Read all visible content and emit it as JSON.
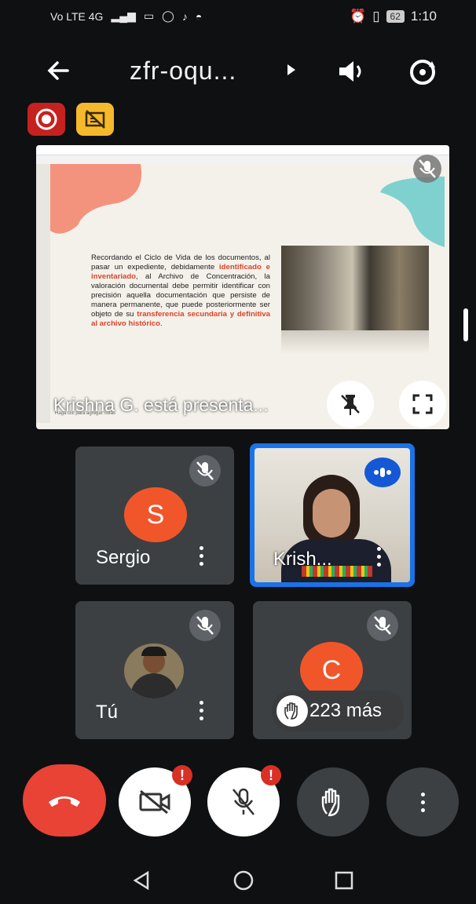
{
  "status_bar": {
    "network": "Vo LTE 4G",
    "battery": "62",
    "time": "1:10"
  },
  "header": {
    "title": "zfr-oqu..."
  },
  "presentation": {
    "slide_text_parts": [
      "Recordando el Ciclo de Vida de los documentos, al pasar un expediente, debidamente ",
      "identificado e inventariado",
      ", al Archivo de Concentración, la valoración documental debe permitir identificar con precisión aquella documentación que persiste de manera permanente, que puede posteriormente ser objeto de su ",
      "transferencia secundaria y definitiva al archivo histórico",
      "."
    ],
    "presenting_label": "Krishna G. está presenta...",
    "notes_hint": "Haga clic para agregar notas",
    "accent_color": "#d8442a"
  },
  "participants": [
    {
      "name": "Sergio",
      "initial": "S",
      "muted": true
    },
    {
      "name": "Krish...",
      "speaking": true
    },
    {
      "name": "Tú",
      "muted": true
    },
    {
      "initial": "C",
      "muted": true
    }
  ],
  "more_participants": "223 más",
  "colors": {
    "end_call": "#e84335",
    "avatar": "#f1562a",
    "speaking_border": "#1a73e8"
  }
}
